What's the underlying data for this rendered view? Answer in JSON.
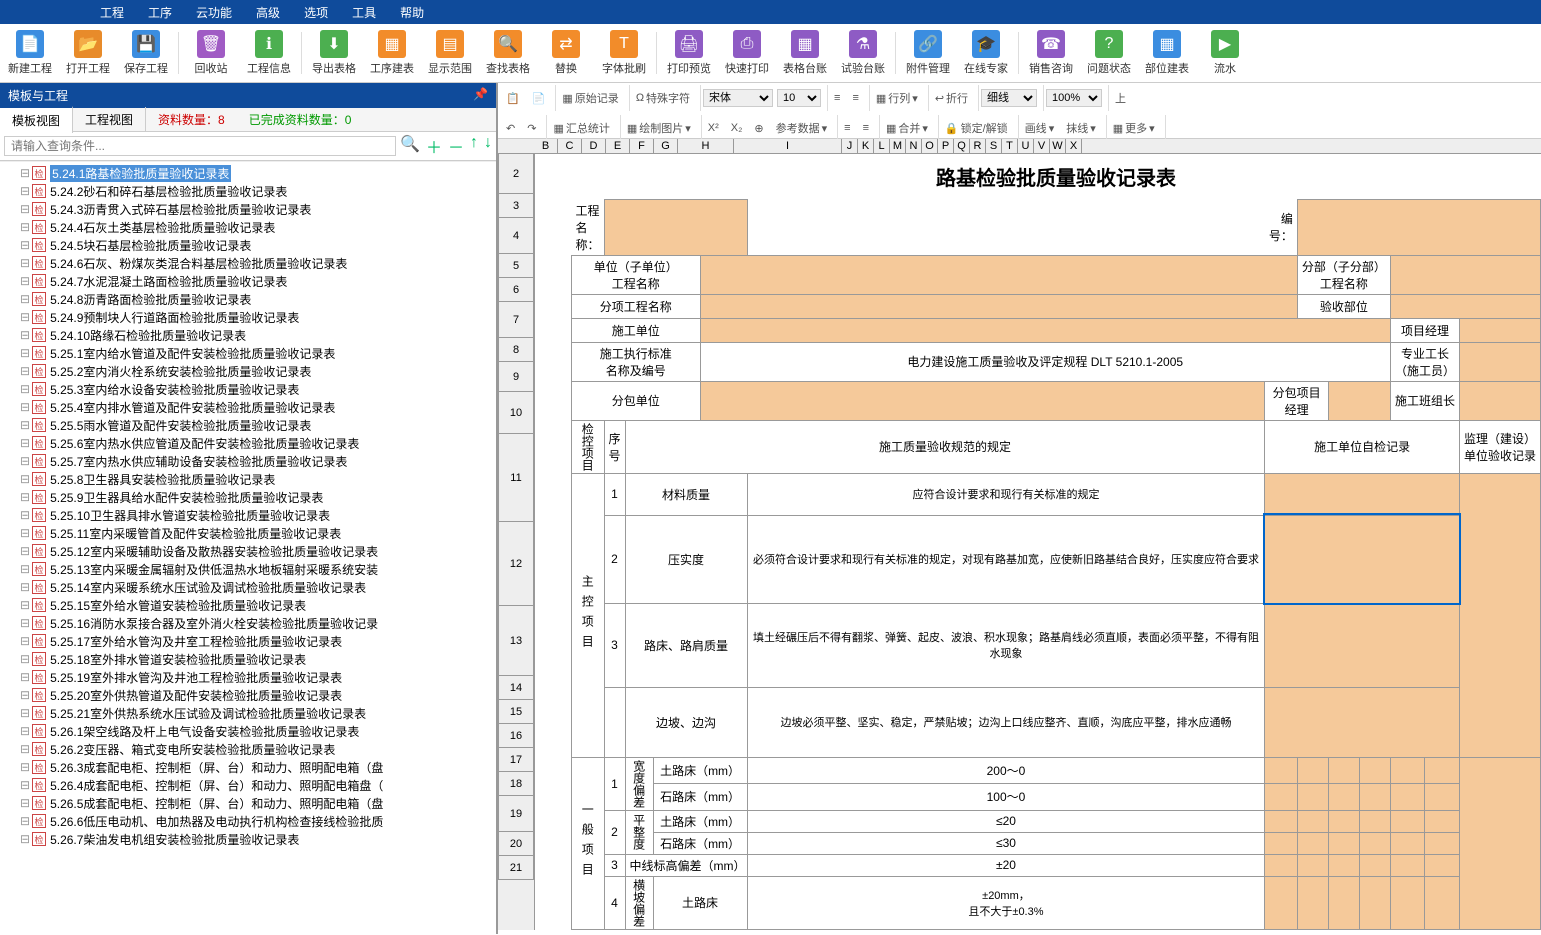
{
  "menu": [
    "工程",
    "工序",
    "云功能",
    "高级",
    "选项",
    "工具",
    "帮助"
  ],
  "toolbar": [
    {
      "label": "新建工程",
      "color": "#3b8de0",
      "g": "📄"
    },
    {
      "label": "打开工程",
      "color": "#e88b2a",
      "g": "📂"
    },
    {
      "label": "保存工程",
      "color": "#3b8de0",
      "g": "💾"
    },
    {
      "label": "回收站",
      "color": "#a05bc4",
      "g": "🗑"
    },
    {
      "label": "工程信息",
      "color": "#4caf50",
      "g": "ℹ"
    },
    {
      "label": "导出表格",
      "color": "#4caf50",
      "g": "⬇"
    },
    {
      "label": "工序建表",
      "color": "#f28c2a",
      "g": "▦"
    },
    {
      "label": "显示范围",
      "color": "#f28c2a",
      "g": "▤"
    },
    {
      "label": "查找表格",
      "color": "#f28c2a",
      "g": "🔍"
    },
    {
      "label": "替换",
      "color": "#f28c2a",
      "g": "⇄"
    },
    {
      "label": "字体批刷",
      "color": "#f28c2a",
      "g": "T"
    },
    {
      "label": "打印预览",
      "color": "#8e5bc4",
      "g": "🖨"
    },
    {
      "label": "快速打印",
      "color": "#8e5bc4",
      "g": "⎙"
    },
    {
      "label": "表格台账",
      "color": "#8e5bc4",
      "g": "▦"
    },
    {
      "label": "试验台账",
      "color": "#8e5bc4",
      "g": "⚗"
    },
    {
      "label": "附件管理",
      "color": "#3b8de0",
      "g": "🔗"
    },
    {
      "label": "在线专家",
      "color": "#3b8de0",
      "g": "🎓"
    },
    {
      "label": "销售咨询",
      "color": "#8e5bc4",
      "g": "☎"
    },
    {
      "label": "问题状态",
      "color": "#4caf50",
      "g": "?"
    },
    {
      "label": "部位建表",
      "color": "#3b8de0",
      "g": "▦"
    },
    {
      "label": "流水",
      "color": "#4caf50",
      "g": "▶"
    }
  ],
  "panel_title": "模板与工程",
  "tabs": {
    "t1": "模板视图",
    "t2": "工程视图"
  },
  "counts": {
    "red_label": "资料数量：",
    "red_val": "8",
    "green_label": "已完成资料数量：",
    "green_val": "0"
  },
  "search_placeholder": "请输入查询条件...",
  "tree": [
    {
      "t": "5.24.1路基检验批质量验收记录表",
      "sel": true
    },
    {
      "t": "5.24.2砂石和碎石基层检验批质量验收记录表"
    },
    {
      "t": "5.24.3沥青贯入式碎石基层检验批质量验收记录表"
    },
    {
      "t": "5.24.4石灰土类基层检验批质量验收记录表"
    },
    {
      "t": "5.24.5块石基层检验批质量验收记录表"
    },
    {
      "t": "5.24.6石灰、粉煤灰类混合料基层检验批质量验收记录表"
    },
    {
      "t": "5.24.7水泥混凝土路面检验批质量验收记录表"
    },
    {
      "t": "5.24.8沥青路面检验批质量验收记录表"
    },
    {
      "t": "5.24.9预制块人行道路面检验批质量验收记录表"
    },
    {
      "t": "5.24.10路缘石检验批质量验收记录表"
    },
    {
      "t": "5.25.1室内给水管道及配件安装检验批质量验收记录表"
    },
    {
      "t": "5.25.2室内消火栓系统安装检验批质量验收记录表"
    },
    {
      "t": "5.25.3室内给水设备安装检验批质量验收记录表"
    },
    {
      "t": "5.25.4室内排水管道及配件安装检验批质量验收记录表"
    },
    {
      "t": "5.25.5雨水管道及配件安装检验批质量验收记录表"
    },
    {
      "t": "5.25.6室内热水供应管道及配件安装检验批质量验收记录表"
    },
    {
      "t": "5.25.7室内热水供应辅助设备安装检验批质量验收记录表"
    },
    {
      "t": "5.25.8卫生器具安装检验批质量验收记录表"
    },
    {
      "t": "5.25.9卫生器具给水配件安装检验批质量验收记录表"
    },
    {
      "t": "5.25.10卫生器具排水管道安装检验批质量验收记录表"
    },
    {
      "t": "5.25.11室内采暖管首及配件安装检验批质量验收记录表"
    },
    {
      "t": "5.25.12室内采暖辅助设备及散热器安装检验批质量验收记录表"
    },
    {
      "t": "5.25.13室内采暖金属辐射及供低温热水地板辐射采暖系统安装"
    },
    {
      "t": "5.25.14室内采暖系统水压试验及调试检验批质量验收记录表"
    },
    {
      "t": "5.25.15室外给水管道安装检验批质量验收记录表"
    },
    {
      "t": "5.25.16消防水泵接合器及室外消火栓安装检验批质量验收记录"
    },
    {
      "t": "5.25.17室外给水管沟及井室工程检验批质量验收记录表"
    },
    {
      "t": "5.25.18室外排水管道安装检验批质量验收记录表"
    },
    {
      "t": "5.25.19室外排水管沟及井池工程检验批质量验收记录表"
    },
    {
      "t": "5.25.20室外供热管道及配件安装检验批质量验收记录表"
    },
    {
      "t": "5.25.21室外供热系统水压试验及调试检验批质量验收记录表"
    },
    {
      "t": "5.26.1架空线路及杆上电气设备安装检验批质量验收记录表"
    },
    {
      "t": "5.26.2变压器、箱式变电所安装检验批质量验收记录表"
    },
    {
      "t": "5.26.3成套配电柜、控制柜（屏、台）和动力、照明配电箱（盘"
    },
    {
      "t": "5.26.4成套配电柜、控制柜（屏、台）和动力、照明配电箱盘（"
    },
    {
      "t": "5.26.5成套配电柜、控制柜（屏、台）和动力、照明配电箱（盘"
    },
    {
      "t": "5.26.6低压电动机、电加热器及电动执行机构检查接线检验批质"
    },
    {
      "t": "5.26.7柴油发电机组安装检验批质量验收记录表"
    }
  ],
  "edit": {
    "orig": "原始记录",
    "spec": "特殊字符",
    "font": "宋体",
    "size": "10",
    "row": "行列",
    "wrap": "折行",
    "line": "细线",
    "zoom": "100%",
    "stat": "汇总统计",
    "img": "绘制图片",
    "ref": "参考数据",
    "merge": "合并",
    "lock": "锁定/解锁",
    "border": "画线",
    "dash": "抹线",
    "more": "更多"
  },
  "cols": [
    "B",
    "C",
    "D",
    "E",
    "F",
    "G",
    "H",
    "I",
    "J",
    "K",
    "L",
    "M",
    "N",
    "O",
    "P",
    "Q",
    "R",
    "S",
    "T",
    "U",
    "V",
    "W",
    "X"
  ],
  "doc": {
    "title": "路基检验批质量验收记录表",
    "proj_label": "工程名称：",
    "num_label": "编号：",
    "r1a": "单位（子单位）\n工程名称",
    "r1b": "分部（子分部）\n工程名称",
    "r2a": "分项工程名称",
    "r2b": "验收部位",
    "r3a": "施工单位",
    "r3b": "项目经理",
    "r4a": "施工执行标准\n名称及编号",
    "r4v": "电力建设施工质量验收及评定规程 DLT 5210.1-2005",
    "r4b": "专业工长\n（施工员）",
    "r5a": "分包单位",
    "r5b": "分包项目经理",
    "r5c": "施工班组长",
    "h1": "检控项目",
    "h2": "序号",
    "h3": "施工质量验收规范的规定",
    "h4": "施工单位自检记录",
    "h5": "监理（建设）\n单位验收记录",
    "main_cat": "主控项目",
    "items": [
      {
        "n": "1",
        "name": "材料质量",
        "spec": "应符合设计要求和现行有关标准的规定"
      },
      {
        "n": "2",
        "name": "压实度",
        "spec": "必须符合设计要求和现行有关标准的规定，对现有路基加宽，应使新旧路基结合良好，压实度应符合要求"
      },
      {
        "n": "3",
        "name": "路床、路肩质量",
        "spec": "填土经碾压后不得有翻浆、弹簧、起皮、波浪、积水现象；路基肩线必须直顺，表面必须平整，不得有阻水现象"
      },
      {
        "n": "",
        "name": "边坡、边沟",
        "spec": "边坡必须平整、坚实、稳定，严禁贴坡；边沟上口线应整齐、直顺，沟底应平整，排水应通畅"
      }
    ],
    "general_cat": "一般项目",
    "g": [
      {
        "n": "1",
        "g": "宽度偏差",
        "sub": "土路床（mm）",
        "v": "200～0"
      },
      {
        "n": "",
        "g": "",
        "sub": "石路床（mm）",
        "v": "100～0"
      },
      {
        "n": "2",
        "g": "平整度",
        "sub": "土路床（mm）",
        "v": "≤20"
      },
      {
        "n": "",
        "g": "",
        "sub": "石路床（mm）",
        "v": "≤30"
      },
      {
        "n": "3",
        "g": "中线标高偏差（mm）",
        "sub": "",
        "v": "±20"
      },
      {
        "n": "4",
        "g": "横坡偏差",
        "sub": "土路床",
        "v": "±20mm，\n且不大于±0.3%"
      }
    ]
  }
}
